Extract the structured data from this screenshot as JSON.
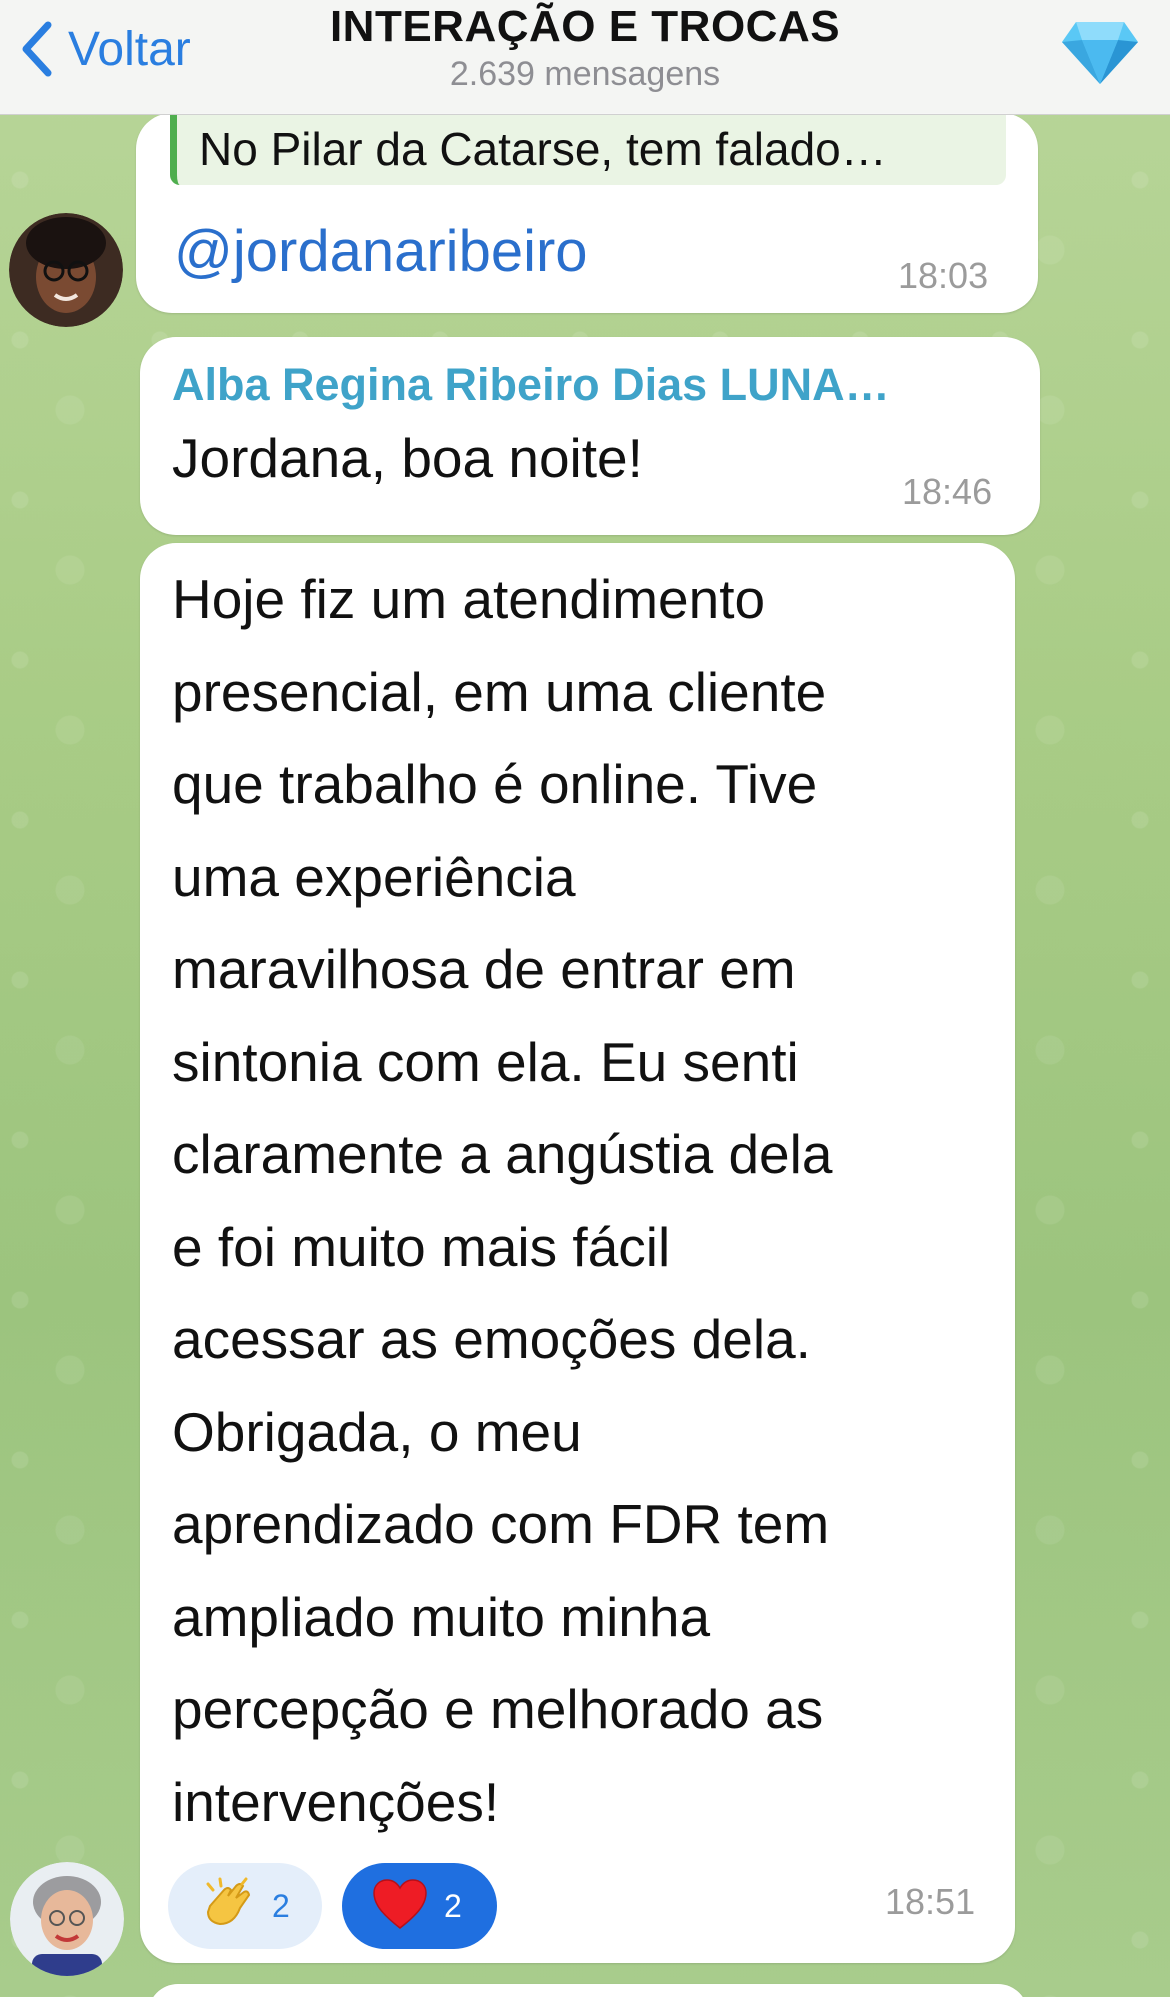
{
  "header": {
    "back_label": "Voltar",
    "title": "INTERAÇÃO E TROCAS",
    "subtitle": "2.639 mensagens"
  },
  "messages": [
    {
      "quote": "No Pilar da Catarse, tem falado…",
      "text": "@jordanaribeiro",
      "time": "18:03"
    },
    {
      "sender": "Alba Regina Ribeiro Dias LUNA…",
      "text": "Jordana,  boa noite!",
      "time": "18:46"
    },
    {
      "lines": [
        "Hoje fiz um atendimento",
        "presencial,  em uma cliente",
        "que trabalho é online.  Tive",
        "uma experiência",
        "maravilhosa de entrar em",
        "sintonia com ela. Eu senti",
        "claramente a angústia dela",
        "e foi muito mais fácil",
        "acessar as emoções dela.",
        "Obrigada,  o meu",
        "aprendizado com FDR tem",
        "ampliado muito minha",
        "percepção e melhorado as",
        "intervenções!"
      ],
      "time": "18:51",
      "reactions": [
        {
          "emoji": "👏",
          "count": "2",
          "chosen": false
        },
        {
          "emoji": "❤",
          "count": "2",
          "chosen": true
        }
      ]
    }
  ],
  "colors": {
    "accent": "#2a7ee0",
    "sender_name": "#3fa3c9",
    "quote_bar": "#4fae4e",
    "reaction_chosen": "#1f6fe0"
  },
  "icons": {
    "back": "chevron-left-icon",
    "premium": "diamond-icon",
    "clap": "clapping-hands-icon",
    "heart": "heart-icon"
  }
}
